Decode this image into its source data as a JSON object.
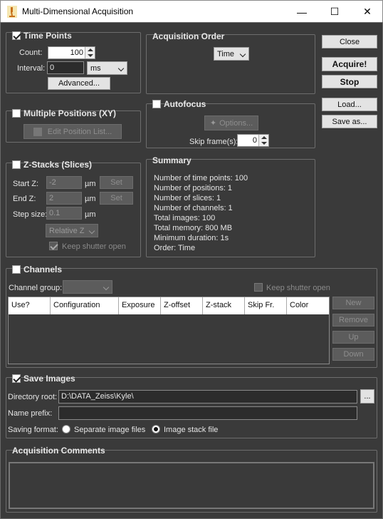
{
  "window": {
    "title": "Multi-Dimensional Acquisition",
    "minimize": "—",
    "maximize": "☐",
    "close": "✕"
  },
  "time_points": {
    "title": "Time Points",
    "count_label": "Count:",
    "count_value": "100",
    "interval_label": "Interval:",
    "interval_value": "0",
    "unit": "ms",
    "advanced": "Advanced..."
  },
  "acquisition_order": {
    "title": "Acquisition Order",
    "value": "Time"
  },
  "buttons": {
    "close": "Close",
    "acquire": "Acquire!",
    "stop": "Stop",
    "load": "Load...",
    "save_as": "Save as..."
  },
  "multiple_positions": {
    "title": "Multiple Positions (XY)",
    "edit": "Edit Position List..."
  },
  "autofocus": {
    "title": "Autofocus",
    "options": "Options...",
    "skip_label": "Skip frame(s):",
    "skip_value": "0"
  },
  "zstacks": {
    "title": "Z-Stacks (Slices)",
    "start_label": "Start Z:",
    "start_value": "-2",
    "end_label": "End Z:",
    "end_value": "2",
    "step_label": "Step size:",
    "step_value": "0.1",
    "unit": "µm",
    "set": "Set",
    "relative": "Relative Z",
    "keep_shutter": "Keep shutter open"
  },
  "summary": {
    "title": "Summary",
    "lines": [
      "Number of time points: 100",
      "Number of positions: 1",
      "Number of slices: 1",
      "Number of channels: 1",
      "Total images: 100",
      "Total memory: 800 MB",
      "Minimum duration: 1s",
      "Order: Time"
    ]
  },
  "channels": {
    "title": "Channels",
    "group_label": "Channel group:",
    "keep_shutter": "Keep shutter open",
    "columns": [
      "Use?",
      "Configuration",
      "Exposure",
      "Z-offset",
      "Z-stack",
      "Skip Fr.",
      "Color"
    ],
    "new": "New",
    "remove": "Remove",
    "up": "Up",
    "down": "Down"
  },
  "save_images": {
    "title": "Save Images",
    "dir_label": "Directory root:",
    "dir_value": "D:\\DATA_Zeiss\\Kyle\\",
    "browse": "...",
    "prefix_label": "Name prefix:",
    "prefix_value": "",
    "format_label": "Saving format:",
    "opt_separate": "Separate image files",
    "opt_stack": "Image stack file"
  },
  "comments": {
    "title": "Acquisition Comments"
  }
}
